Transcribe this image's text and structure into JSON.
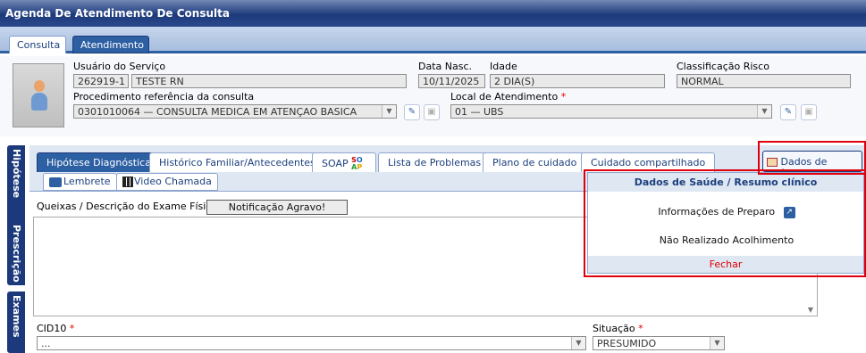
{
  "window": {
    "title": "Agenda De Atendimento De Consulta"
  },
  "top_tabs": [
    {
      "label": "Consulta"
    },
    {
      "label": "Atendimento"
    }
  ],
  "patient": {
    "usuario_label": "Usuário do Serviço",
    "usuario_code": "262919-1",
    "usuario_name": "TESTE RN",
    "data_nasc_label": "Data Nasc.",
    "data_nasc_value": "10/11/2025",
    "idade_label": "Idade",
    "idade_value": "2 DIA(S)",
    "classificacao_label": "Classificação Risco",
    "classificacao_value": "NORMAL",
    "procedimento_label": "Procedimento referência da consulta",
    "procedimento_value": "0301010064 — CONSULTA MEDICA EM ATENÇAO BASICA",
    "local_label": "Local de Atendimento",
    "local_value": "01 — UBS",
    "required_mark": "*"
  },
  "side_tabs": [
    {
      "label": "Hipótese"
    },
    {
      "label": "Prescrição"
    },
    {
      "label": "Exames"
    }
  ],
  "section_tabs": [
    {
      "label": "Hipótese Diagnóstica"
    },
    {
      "label": "Histórico Familiar/Antecedentes"
    },
    {
      "label": "SOAP"
    },
    {
      "label": "Lista de Problemas"
    },
    {
      "label": "Plano de cuidado"
    },
    {
      "label": "Cuidado compartilhado"
    }
  ],
  "soap_badge": {
    "s": "S",
    "o": "O",
    "a": "A",
    "p": "P"
  },
  "dados_saude_button": {
    "label": "Dados de Saúde"
  },
  "sub_tabs": [
    {
      "label": "Lembrete"
    },
    {
      "label": "Video Chamada"
    }
  ],
  "form": {
    "queixas_label": "Queixas / Descrição do Exame Físico",
    "notificacao_button": "Notificação Agravo!",
    "cid10_label": "CID10",
    "cid10_value": "...",
    "situacao_label": "Situação",
    "situacao_value": "PRESUMIDO"
  },
  "popup": {
    "title": "Dados de Saúde / Resumo clínico",
    "informacoes": "Informações de Preparo",
    "nao_realizado": "Não Realizado Acolhimento",
    "fechar": "Fechar"
  },
  "colors": {
    "accent": "#2d5fa3",
    "title_bar": "#1c3a7b",
    "highlight_border": "#e0000b",
    "required": "#d00000"
  }
}
